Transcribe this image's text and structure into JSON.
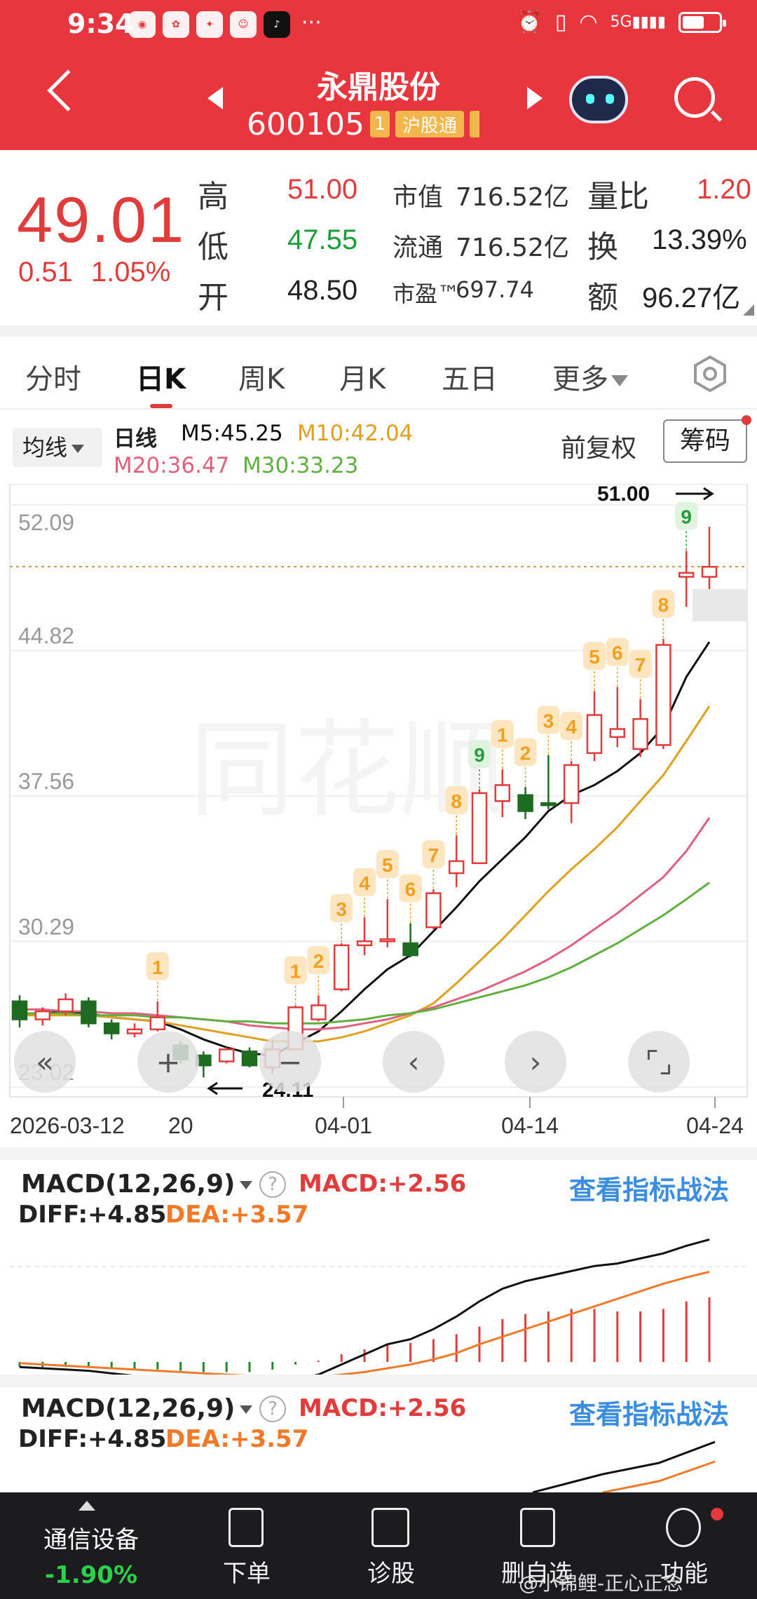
{
  "status_bar": {
    "time": "9:34",
    "app_icons": [
      "weibo-icon",
      "huawei-icon",
      "app-icon",
      "avatar-icon",
      "tiktok-icon"
    ],
    "more": "···",
    "network": "5G"
  },
  "header": {
    "stock_name": "永鼎股份",
    "stock_code": "600105",
    "badge_level": "1",
    "badge_market": "沪股通"
  },
  "quote": {
    "price": "49.01",
    "change": "0.51",
    "change_pct": "1.05%",
    "high_label": "高",
    "high": "51.00",
    "low_label": "低",
    "low": "47.55",
    "open_label": "开",
    "open": "48.50",
    "mktcap_label": "市值",
    "mktcap": "716.52亿",
    "float_label": "流通",
    "float": "716.52亿",
    "pe_label": "市盈™",
    "pe": "697.74",
    "volratio_label": "量比",
    "volratio": "1.20",
    "turnover_label": "换",
    "turnover": "13.39%",
    "amount_label": "额",
    "amount": "96.27亿"
  },
  "tabs": [
    "分时",
    "日K",
    "周K",
    "月K",
    "五日",
    "更多"
  ],
  "active_tab": "日K",
  "ma": {
    "selector": "均线",
    "period": "日线",
    "m5": "M5:45.25",
    "m10": "M10:42.04",
    "m20": "M20:36.47",
    "m30": "M30:33.23",
    "adjust": "前复权",
    "chips": "筹码"
  },
  "colors": {
    "header": "#e8363f",
    "up": "#e03c3c",
    "down": "#1f6b22",
    "m5": "#111111",
    "m10": "#e0a020",
    "m20": "#e06080",
    "m30": "#60b040",
    "link": "#3b8de0",
    "dea": "#f07a2a"
  },
  "chart_data": {
    "type": "candlestick",
    "ylim": [
      23.02,
      52.09
    ],
    "y_ticks": [
      "52.09",
      "44.82",
      "37.56",
      "30.29",
      "23.02"
    ],
    "x_ticks": [
      "2026-03-12",
      "20",
      "04-01",
      "04-14",
      "04-24"
    ],
    "high_marker": "51.00",
    "low_marker": "24.11",
    "candles": [
      {
        "o": 27.3,
        "c": 26.4,
        "h": 27.6,
        "l": 26.0
      },
      {
        "o": 26.4,
        "c": 26.8,
        "h": 27.0,
        "l": 26.1
      },
      {
        "o": 26.8,
        "c": 27.4,
        "h": 27.7,
        "l": 26.6
      },
      {
        "o": 27.3,
        "c": 26.2,
        "h": 27.5,
        "l": 26.0
      },
      {
        "o": 26.2,
        "c": 25.7,
        "h": 26.4,
        "l": 25.4
      },
      {
        "o": 25.7,
        "c": 25.9,
        "h": 26.2,
        "l": 25.5
      },
      {
        "o": 25.9,
        "c": 26.5,
        "h": 27.3,
        "l": 25.8
      },
      {
        "o": 25.1,
        "c": 24.4,
        "h": 25.3,
        "l": 24.2
      },
      {
        "o": 24.6,
        "c": 24.1,
        "h": 24.8,
        "l": 23.5
      },
      {
        "o": 24.3,
        "c": 24.9,
        "h": 25.0,
        "l": 24.2
      },
      {
        "o": 24.8,
        "c": 24.1,
        "h": 25.0,
        "l": 24.0
      },
      {
        "o": 24.0,
        "c": 24.9,
        "h": 25.4,
        "l": 23.7
      },
      {
        "o": 24.9,
        "c": 27.0,
        "h": 27.1,
        "l": 24.9
      },
      {
        "o": 26.4,
        "c": 27.1,
        "h": 27.6,
        "l": 26.3
      },
      {
        "o": 27.9,
        "c": 30.1,
        "h": 30.2,
        "l": 27.8
      },
      {
        "o": 30.1,
        "c": 30.3,
        "h": 31.5,
        "l": 29.6
      },
      {
        "o": 30.3,
        "c": 30.4,
        "h": 32.4,
        "l": 30.0
      },
      {
        "o": 30.2,
        "c": 29.6,
        "h": 31.2,
        "l": 29.5
      },
      {
        "o": 31.0,
        "c": 32.7,
        "h": 32.9,
        "l": 30.9
      },
      {
        "o": 33.7,
        "c": 34.3,
        "h": 35.6,
        "l": 33.0
      },
      {
        "o": 34.2,
        "c": 37.7,
        "h": 37.9,
        "l": 34.2
      },
      {
        "o": 37.3,
        "c": 38.1,
        "h": 38.9,
        "l": 36.5
      },
      {
        "o": 37.6,
        "c": 36.8,
        "h": 38.0,
        "l": 36.4
      },
      {
        "o": 37.2,
        "c": 37.1,
        "h": 39.6,
        "l": 36.9
      },
      {
        "o": 37.2,
        "c": 39.1,
        "h": 39.3,
        "l": 36.2
      },
      {
        "o": 39.7,
        "c": 41.6,
        "h": 42.8,
        "l": 39.3
      },
      {
        "o": 40.5,
        "c": 40.9,
        "h": 43.0,
        "l": 40.0
      },
      {
        "o": 39.9,
        "c": 41.4,
        "h": 42.4,
        "l": 39.5
      },
      {
        "o": 40.1,
        "c": 45.1,
        "h": 45.4,
        "l": 39.9
      },
      {
        "o": 48.5,
        "c": 48.7,
        "h": 49.8,
        "l": 47.0
      },
      {
        "o": 48.5,
        "c": 49.0,
        "h": 51.0,
        "l": 47.5
      }
    ],
    "td_counts": [
      {
        "i": 6,
        "n": "1",
        "color": "orange"
      },
      {
        "i": 12,
        "n": "1",
        "color": "orange"
      },
      {
        "i": 13,
        "n": "2",
        "color": "orange"
      },
      {
        "i": 14,
        "n": "3",
        "color": "orange"
      },
      {
        "i": 15,
        "n": "4",
        "color": "orange"
      },
      {
        "i": 16,
        "n": "5",
        "color": "orange"
      },
      {
        "i": 17,
        "n": "6",
        "color": "orange"
      },
      {
        "i": 18,
        "n": "7",
        "color": "orange"
      },
      {
        "i": 19,
        "n": "8",
        "color": "orange"
      },
      {
        "i": 20,
        "n": "9",
        "color": "green"
      },
      {
        "i": 21,
        "n": "1",
        "color": "orange"
      },
      {
        "i": 22,
        "n": "2",
        "color": "orange"
      },
      {
        "i": 23,
        "n": "3",
        "color": "orange"
      },
      {
        "i": 24,
        "n": "4",
        "color": "orange"
      },
      {
        "i": 25,
        "n": "5",
        "color": "orange"
      },
      {
        "i": 26,
        "n": "6",
        "color": "orange"
      },
      {
        "i": 27,
        "n": "7",
        "color": "orange"
      },
      {
        "i": 28,
        "n": "8",
        "color": "orange"
      },
      {
        "i": 29,
        "n": "9",
        "color": "green"
      }
    ],
    "ma_series": [
      {
        "name": "M5",
        "values": [
          26.6,
          26.7,
          26.8,
          26.7,
          26.5,
          26.4,
          26.3,
          25.9,
          25.4,
          25.0,
          24.7,
          24.6,
          25.2,
          25.8,
          26.8,
          27.9,
          28.9,
          29.6,
          30.8,
          32.0,
          33.3,
          34.4,
          35.5,
          36.8,
          37.6,
          38.1,
          38.8,
          39.7,
          41.0,
          43.5,
          45.25
        ]
      },
      {
        "name": "M10",
        "values": [
          26.6,
          26.6,
          26.6,
          26.6,
          26.5,
          26.4,
          26.3,
          26.1,
          25.9,
          25.7,
          25.5,
          25.3,
          25.3,
          25.3,
          25.5,
          25.8,
          26.2,
          26.6,
          27.2,
          28.2,
          29.3,
          30.4,
          31.6,
          32.8,
          33.9,
          34.9,
          36.0,
          37.3,
          38.6,
          40.3,
          42.04
        ]
      },
      {
        "name": "M20",
        "values": [
          26.9,
          26.9,
          26.8,
          26.8,
          26.7,
          26.7,
          26.6,
          26.5,
          26.4,
          26.3,
          26.1,
          26.0,
          25.9,
          25.9,
          26.0,
          26.2,
          26.4,
          26.7,
          27.0,
          27.4,
          27.8,
          28.3,
          28.8,
          29.4,
          30.1,
          30.9,
          31.7,
          32.6,
          33.5,
          34.8,
          36.47
        ]
      },
      {
        "name": "M30",
        "values": [
          26.7,
          26.7,
          26.7,
          26.6,
          26.6,
          26.6,
          26.5,
          26.5,
          26.4,
          26.3,
          26.3,
          26.2,
          26.2,
          26.2,
          26.3,
          26.4,
          26.6,
          26.7,
          26.9,
          27.2,
          27.5,
          27.8,
          28.1,
          28.5,
          29.0,
          29.6,
          30.2,
          30.9,
          31.6,
          32.4,
          33.23
        ]
      }
    ]
  },
  "macd_panels": [
    {
      "name": "MACD(12,26,9)",
      "macd": "MACD:+2.56",
      "diff": "DIFF:+4.85",
      "dea": "DEA:+3.57",
      "link": "查看指标战法",
      "hist": [
        -0.2,
        -0.2,
        -0.2,
        -0.2,
        -0.25,
        -0.3,
        -0.3,
        -0.35,
        -0.4,
        -0.4,
        -0.4,
        -0.3,
        -0.1,
        0.05,
        0.3,
        0.5,
        0.7,
        0.75,
        0.9,
        1.1,
        1.4,
        1.7,
        1.9,
        2.0,
        2.1,
        2.1,
        2.0,
        2.0,
        2.1,
        2.4,
        2.56
      ],
      "diff_values": [
        -0.2,
        -0.25,
        -0.3,
        -0.35,
        -0.45,
        -0.55,
        -0.6,
        -0.7,
        -0.8,
        -0.85,
        -0.9,
        -0.85,
        -0.7,
        -0.5,
        -0.1,
        0.3,
        0.7,
        0.9,
        1.3,
        1.8,
        2.4,
        2.9,
        3.2,
        3.4,
        3.6,
        3.8,
        3.9,
        4.1,
        4.3,
        4.6,
        4.85
      ],
      "dea_values": [
        -0.05,
        -0.1,
        -0.15,
        -0.2,
        -0.25,
        -0.3,
        -0.35,
        -0.4,
        -0.45,
        -0.5,
        -0.55,
        -0.6,
        -0.6,
        -0.6,
        -0.5,
        -0.4,
        -0.25,
        -0.1,
        0.1,
        0.35,
        0.7,
        1.0,
        1.3,
        1.6,
        1.9,
        2.2,
        2.5,
        2.8,
        3.1,
        3.35,
        3.57
      ]
    },
    {
      "name": "MACD(12,26,9)",
      "macd": "MACD:+2.56",
      "diff": "DIFF:+4.85",
      "dea": "DEA:+3.57",
      "link": "查看指标战法"
    }
  ],
  "bottom_nav": {
    "sector_name": "通信设备",
    "sector_pct": "-1.90%",
    "items": [
      "下单",
      "诊股",
      "删自选",
      "功能"
    ],
    "watermark": "@小锦鲤-正心正念"
  }
}
